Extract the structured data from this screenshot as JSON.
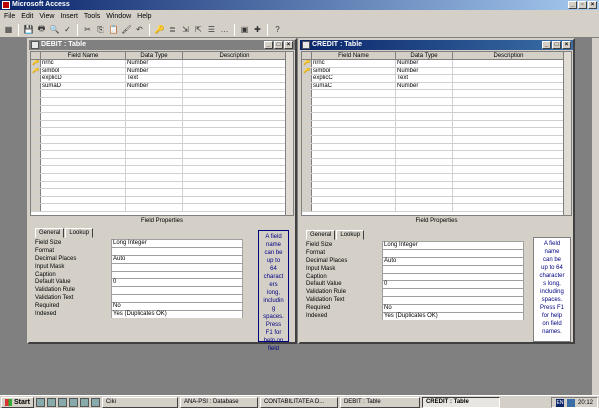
{
  "app": {
    "title": "Microsoft Access"
  },
  "menu": [
    "File",
    "Edit",
    "View",
    "Insert",
    "Tools",
    "Window",
    "Help"
  ],
  "toolbar": {
    "icons": [
      "view-icon",
      "save-icon",
      "print-icon",
      "preview-icon",
      "spell-icon",
      "cut-icon",
      "copy-icon",
      "paste-icon",
      "format-painter-icon",
      "undo-icon",
      "primary-key-icon",
      "indexes-icon",
      "insert-rows-icon",
      "delete-rows-icon",
      "properties-icon",
      "build-icon",
      "database-window-icon",
      "new-object-icon",
      "help-icon"
    ]
  },
  "debit": {
    "title": "DEBIT : Table",
    "headers": [
      "Field Name",
      "Data Type",
      "Description"
    ],
    "rows": [
      {
        "key": "🔑",
        "field": "nrnc",
        "type": "Number",
        "desc": ""
      },
      {
        "key": "🔑",
        "field": "simbol",
        "type": "Number",
        "desc": ""
      },
      {
        "key": "",
        "field": "explicD",
        "type": "Text",
        "desc": ""
      },
      {
        "key": "",
        "field": "sumaD",
        "type": "Number",
        "desc": ""
      }
    ],
    "field_properties_label": "Field Properties",
    "tabs": [
      "General",
      "Lookup"
    ],
    "props": [
      {
        "label": "Field Size",
        "value": "Long Integer"
      },
      {
        "label": "Format",
        "value": ""
      },
      {
        "label": "Decimal Places",
        "value": "Auto"
      },
      {
        "label": "Input Mask",
        "value": ""
      },
      {
        "label": "Caption",
        "value": ""
      },
      {
        "label": "Default Value",
        "value": "0"
      },
      {
        "label": "Validation Rule",
        "value": ""
      },
      {
        "label": "Validation Text",
        "value": ""
      },
      {
        "label": "Required",
        "value": "No"
      },
      {
        "label": "Indexed",
        "value": "Yes (Duplicates OK)"
      }
    ],
    "help_lines": [
      "A field",
      "name",
      "can be",
      "up to",
      "64",
      "charact",
      "ers",
      "long,",
      "includin",
      "g",
      "spaces.",
      "Press",
      "F1 for",
      "help on",
      "field"
    ]
  },
  "credit": {
    "title": "CREDIT : Table",
    "headers": [
      "Field Name",
      "Data Type",
      "Description"
    ],
    "rows": [
      {
        "key": "🔑",
        "field": "nrnc",
        "type": "Number",
        "desc": ""
      },
      {
        "key": "🔑",
        "field": "simbol",
        "type": "Number",
        "desc": ""
      },
      {
        "key": "",
        "field": "explicC",
        "type": "Text",
        "desc": ""
      },
      {
        "key": "",
        "field": "sumaC",
        "type": "Number",
        "desc": ""
      }
    ],
    "field_properties_label": "Field Properties",
    "tabs": [
      "General",
      "Lookup"
    ],
    "props": [
      {
        "label": "Field Size",
        "value": "Long Integer"
      },
      {
        "label": "Format",
        "value": ""
      },
      {
        "label": "Decimal Places",
        "value": "Auto"
      },
      {
        "label": "Input Mask",
        "value": ""
      },
      {
        "label": "Caption",
        "value": ""
      },
      {
        "label": "Default Value",
        "value": "0"
      },
      {
        "label": "Validation Rule",
        "value": ""
      },
      {
        "label": "Validation Text",
        "value": ""
      },
      {
        "label": "Required",
        "value": "No"
      },
      {
        "label": "Indexed",
        "value": "Yes (Duplicates OK)"
      }
    ],
    "help_lines": [
      "A field",
      "name",
      "can be",
      "up to 64",
      "character",
      "s long,",
      "including",
      "spaces.",
      "Press F1",
      "for help",
      "on field",
      "names."
    ]
  },
  "taskbar": {
    "start": "Start",
    "tasks": [
      "Ciki",
      "ANA-PSI : Database",
      "CONTABILITATEA D...",
      "DEBIT : Table",
      "CREDIT : Table"
    ],
    "clock": "20:12"
  }
}
